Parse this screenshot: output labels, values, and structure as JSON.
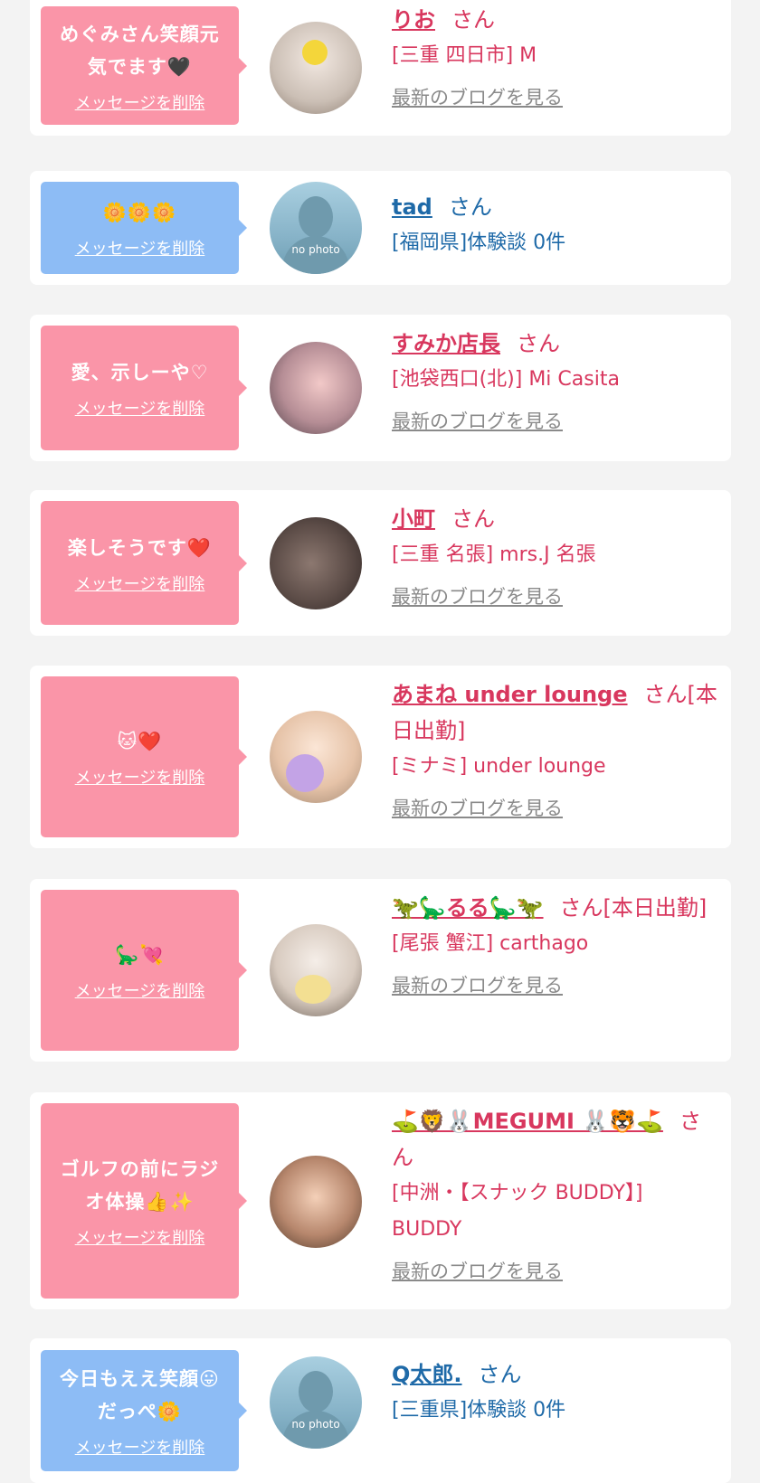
{
  "delete_label": "メッセージを削除",
  "blog_label": "最新のブログを見る",
  "san_label": "さん",
  "no_photo_label": "no photo",
  "colors": {
    "pink_bubble": "#fa95a8",
    "blue_bubble": "#8dbcf5",
    "pink_text": "#d8375e",
    "blue_text": "#1f6aa8"
  },
  "items": [
    {
      "message": "めぐみさん笑顔元\n気でます🖤",
      "name": "りお",
      "san_suffix": "さん",
      "shop": "[三重 四日市] M",
      "avatar": "photo"
    },
    {
      "message": "🌼🌼🌼",
      "name": "tad",
      "san_suffix": "さん",
      "shop": "[福岡県]体験談 0件",
      "avatar": "no-photo"
    },
    {
      "message": "愛、示しーや♡",
      "name": "すみか店長",
      "san_suffix": "さん",
      "shop": "[池袋西口(北)] Mi Casita",
      "avatar": "photo"
    },
    {
      "message": "楽しそうです❤️",
      "name": "小町",
      "san_suffix": "さん",
      "shop": "[三重 名張] mrs.J 名張",
      "avatar": "photo"
    },
    {
      "message": "🐱❤️",
      "name": "あまね under lounge",
      "san_suffix": "さん[本日出勤]",
      "shop": "[ミナミ] under lounge",
      "avatar": "photo"
    },
    {
      "message": "🦕💘",
      "name": "🦖🦕るる🦕🦖",
      "san_suffix": "さん[本日出勤]",
      "shop": "[尾張 蟹江] carthago",
      "avatar": "photo"
    },
    {
      "message": "ゴルフの前にラジ\nオ体操👍✨",
      "name": "⛳🦁🐰MEGUMI 🐰🐯⛳",
      "san_suffix": "さん",
      "shop": "[中洲・【スナック BUDDY】] BUDDY",
      "avatar": "photo"
    },
    {
      "message": "今日もええ笑顔😛\nだっぺ🌼",
      "name": "Q太郎.",
      "san_suffix": "さん",
      "shop": "[三重県]体験談 0件",
      "avatar": "no-photo"
    }
  ]
}
